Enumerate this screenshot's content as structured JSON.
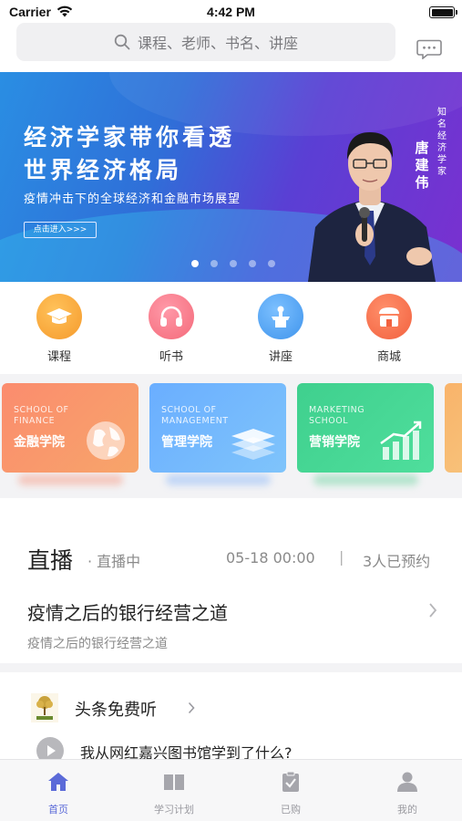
{
  "status_bar": {
    "carrier": "Carrier",
    "time": "4:42 PM"
  },
  "search": {
    "placeholder": "课程、老师、书名、讲座"
  },
  "banner": {
    "title_line1": "经济学家带你看透",
    "title_line2": "世界经济格局",
    "subtitle": "疫情冲击下的全球经济和金融市场展望",
    "enter_button": "点击进入>>>",
    "tag": "知名经济学家",
    "name": "唐建伟",
    "dots_count": 5,
    "active_dot": 0
  },
  "categories": [
    {
      "label": "课程",
      "icon": "graduation-cap-icon",
      "color": "#f59a2c"
    },
    {
      "label": "听书",
      "icon": "headphones-icon",
      "color": "#f46a7a"
    },
    {
      "label": "讲座",
      "icon": "podium-icon",
      "color": "#3f94ec"
    },
    {
      "label": "商城",
      "icon": "shop-icon",
      "color": "#f2613f"
    }
  ],
  "schools": [
    {
      "en_line1": "SCHOOL OF",
      "en_line2": "FINANCE",
      "name": "金融学院",
      "icon": "globe-icon"
    },
    {
      "en_line1": "SCHOOL OF",
      "en_line2": "MANAGEMENT",
      "name": "管理学院",
      "icon": "layers-icon"
    },
    {
      "en_line1": "MARKETING",
      "en_line2": "SCHOOL",
      "name": "营销学院",
      "icon": "growth-chart-icon"
    }
  ],
  "live": {
    "title": "直播",
    "status": "· 直播中",
    "time": "05-18 00:00",
    "separator": "|",
    "count": "3人已预约",
    "course_title": "疫情之后的银行经营之道",
    "course_subtitle": "疫情之后的银行经营之道"
  },
  "headline": {
    "title": "头条免费听",
    "item": "我从网红嘉兴图书馆学到了什么?"
  },
  "tabbar": [
    {
      "label": "首页",
      "icon": "home-icon",
      "active": true
    },
    {
      "label": "学习计划",
      "icon": "book-icon",
      "active": false
    },
    {
      "label": "已购",
      "icon": "clipboard-check-icon",
      "active": false
    },
    {
      "label": "我的",
      "icon": "user-icon",
      "active": false
    }
  ],
  "colors": {
    "accent": "#5b6ad8",
    "tab_inactive": "#9a9aa0"
  }
}
